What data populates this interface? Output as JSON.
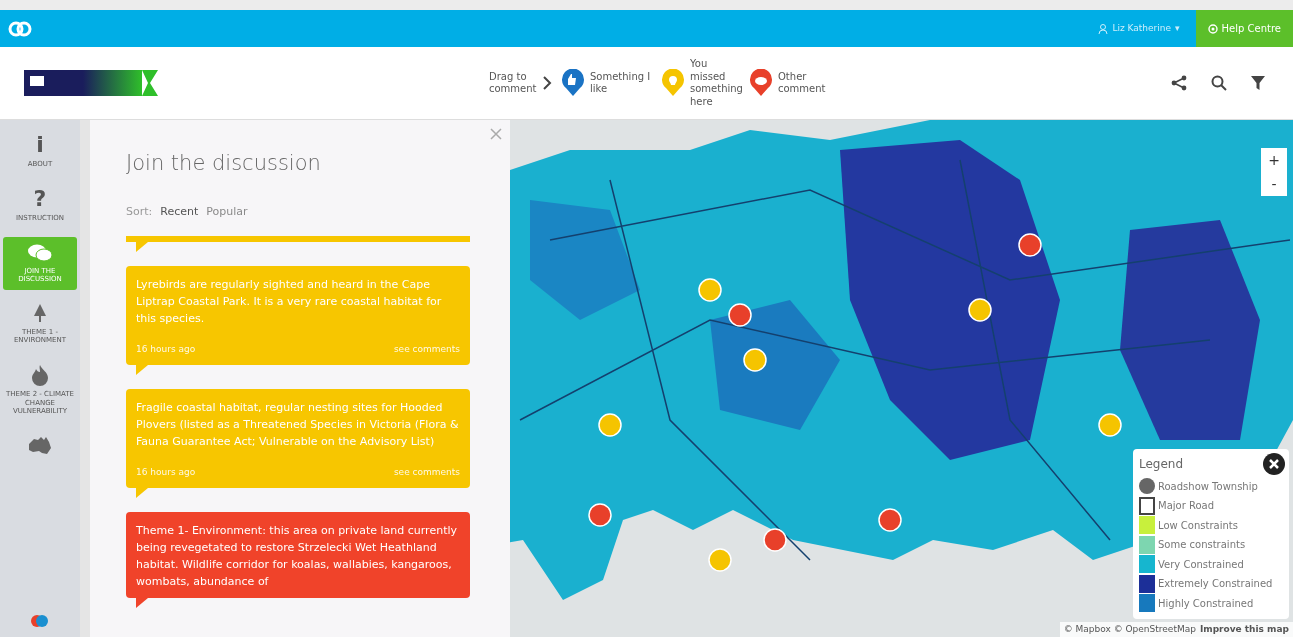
{
  "topbar": {
    "user": "Liz Katherine",
    "caret": "▾",
    "help": "Help Centre"
  },
  "drag_bar": {
    "prompt": "Drag to comment",
    "items": [
      {
        "label": "Something I like",
        "color": "#1a73c4",
        "kind": "like"
      },
      {
        "label": "You missed something here",
        "color": "#f5c400",
        "kind": "idea"
      },
      {
        "label": "Other comment",
        "color": "#e8402a",
        "kind": "comment"
      }
    ]
  },
  "sidebar": {
    "items": [
      {
        "label": "ABOUT",
        "kind": "glyph",
        "glyph": "i",
        "selected": false
      },
      {
        "label": "INSTRUCTION",
        "kind": "glyph",
        "glyph": "?",
        "selected": false
      },
      {
        "label": "JOIN THE DISCUSSION",
        "kind": "chat",
        "selected": true
      },
      {
        "label": "THEME 1 - ENVIRONMENT",
        "kind": "tree",
        "selected": false
      },
      {
        "label": "THEME 2 - CLIMATE CHANGE VULNERABILITY",
        "kind": "fire",
        "selected": false
      },
      {
        "kind": "australia",
        "selected": false
      }
    ]
  },
  "panel": {
    "title": "Join the discussion",
    "sort_label": "Sort:",
    "sort_options": [
      {
        "label": "Recent",
        "selected": true
      },
      {
        "label": "Popular",
        "selected": false
      }
    ],
    "comments": [
      {
        "kind": "idea",
        "text": "Lyrebirds are regularly sighted and heard in the Cape Liptrap Coastal Park. It is a very rare coastal habitat for this species.",
        "time": "16 hours ago",
        "action": "see comments"
      },
      {
        "kind": "idea",
        "text": "Fragile coastal habitat, regular nesting sites for Hooded Plovers (listed as a Threatened Species in Victoria (Flora & Fauna Guarantee Act; Vulnerable on the Advisory List)",
        "time": "16 hours ago",
        "action": "see comments"
      },
      {
        "kind": "comment",
        "text": "Theme 1- Environment: this area on private land currently being revegetated to restore Strzelecki Wet Heathland habitat. Wildlife corridor for koalas, wallabies, kangaroos, wombats, abundance of"
      }
    ]
  },
  "map": {
    "zoom_in": "+",
    "zoom_out": "-",
    "attribution": "© Mapbox © OpenStreetMap",
    "improve": "Improve this map",
    "legend": {
      "title": "Legend",
      "items": [
        {
          "label": "Roadshow Township",
          "kind": "dot",
          "color": "#666666"
        },
        {
          "label": "Major Road",
          "kind": "outline",
          "color": "#444444"
        },
        {
          "label": "Low Constraints",
          "kind": "fill",
          "color": "#c8f03c"
        },
        {
          "label": "Some constraints",
          "kind": "fill",
          "color": "#7dd6b0"
        },
        {
          "label": "Very Constrained",
          "kind": "fill",
          "color": "#16b6cf"
        },
        {
          "label": "Extremely Constrained",
          "kind": "fill",
          "color": "#1c2f98"
        },
        {
          "label": "Highly Constrained",
          "kind": "fill",
          "color": "#1779bd"
        }
      ]
    }
  }
}
